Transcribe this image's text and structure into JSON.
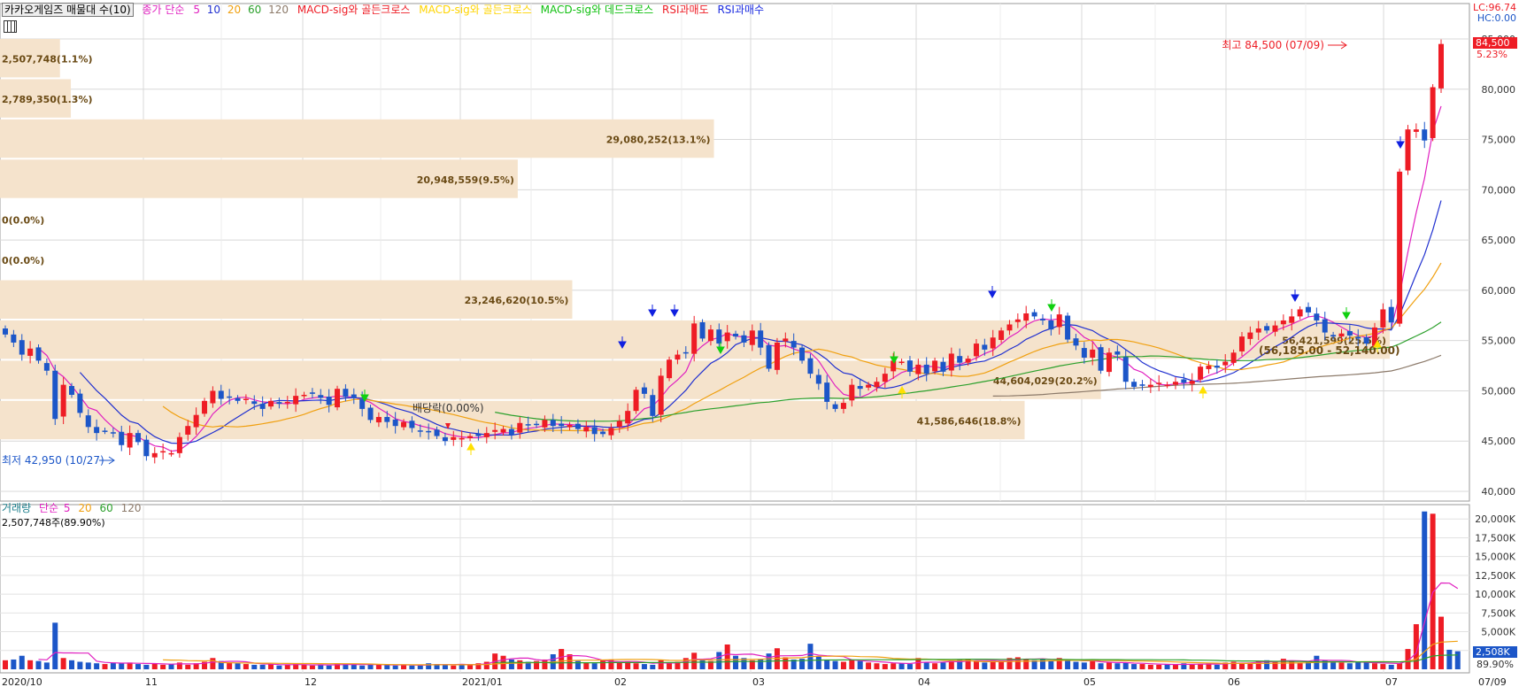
{
  "legend": {
    "title": "카카오게임즈 매물대 수(10)",
    "ma_label": "종가 단순",
    "ma5": "5",
    "ma10": "10",
    "ma20": "20",
    "ma60": "60",
    "ma120": "120",
    "sig1": "MACD-sig와 골든크로스",
    "sig2": "MACD-sig와 골든크로스",
    "sig3": "MACD-sig와 데드크로스",
    "sig4": "RSI과매도",
    "sig5": "RSI과매수"
  },
  "corner": {
    "lc": "LC:96.74",
    "hc": "HC:0.00"
  },
  "volume_legend": {
    "title": "거래량",
    "ma_label": "단순",
    "ma5": "5",
    "ma20": "20",
    "ma60": "60",
    "ma120": "120",
    "current": "2,507,748주(89.90%)"
  },
  "colors": {
    "up": "#ee1c25",
    "down": "#1c56c8",
    "ma5": "#e020c0",
    "ma10": "#2030d0",
    "ma20": "#f0a010",
    "ma60": "#2ca02c",
    "ma120": "#8c7a6a",
    "profile": "#f5e3cc",
    "profile_text": "#6a4a14"
  },
  "chart_data": {
    "type": "candlestick",
    "title": "카카오게임즈",
    "price_axis": {
      "ylim": [
        40000,
        85000
      ],
      "ticks": [
        "40,000",
        "45,000",
        "50,000",
        "55,000",
        "60,000",
        "65,000",
        "70,000",
        "75,000",
        "80,000",
        "85,000"
      ]
    },
    "x_labels": [
      "2020/10",
      "11",
      "12",
      "2021/01",
      "02",
      "03",
      "04",
      "05",
      "06",
      "07",
      "07/09"
    ],
    "volume_profile": [
      {
        "price_low": 85000,
        "price_high": 81000,
        "label": "2,507,748(1.1%)",
        "pct": 1.1
      },
      {
        "price_low": 81000,
        "price_high": 77000,
        "label": "2,789,350(1.3%)",
        "pct": 1.3
      },
      {
        "price_low": 77000,
        "price_high": 73000,
        "label": "29,080,252(13.1%)",
        "pct": 13.1
      },
      {
        "price_low": 73000,
        "price_high": 69000,
        "label": "20,948,559(9.5%)",
        "pct": 9.5
      },
      {
        "price_low": 69000,
        "price_high": 65000,
        "label": "0(0.0%)",
        "pct": 0.0
      },
      {
        "price_low": 65000,
        "price_high": 61000,
        "label": "0(0.0%)",
        "pct": 0.0
      },
      {
        "price_low": 61000,
        "price_high": 57000,
        "label": "23,246,620(10.5%)",
        "pct": 10.5
      },
      {
        "price_low": 57000,
        "price_high": 53000,
        "label": "56,421,599(25.5%)",
        "pct": 25.5
      },
      {
        "price_low": 53000,
        "price_high": 49000,
        "label": "44,604,029(20.2%)",
        "pct": 20.2
      },
      {
        "price_low": 49000,
        "price_high": 45000,
        "label": "41,586,646(18.8%)",
        "pct": 18.8
      }
    ],
    "annotations": {
      "high": "최고 84,500 (07/09)",
      "low": "최저 42,950 (10/27)",
      "dividend": "배당락(0.00%)",
      "ma_values": "(56,185.00 - 52,140.00)",
      "last_price": "84,500",
      "last_change": "5.23%",
      "last_volume": "2,508K",
      "last_volume_pct": "89.90%"
    },
    "volume_axis": {
      "ylim": [
        0,
        22500
      ],
      "ticks": [
        "2,500K",
        "5,000K",
        "7,500K",
        "10,000K",
        "12,500K",
        "15,000K",
        "17,500K",
        "20,000K"
      ]
    },
    "grid": true,
    "closes": [
      55600,
      54800,
      53600,
      54200,
      53000,
      52000,
      47200,
      50600,
      49600,
      47800,
      46400,
      45800,
      46000,
      45800,
      44600,
      45800,
      44900,
      43500,
      43800,
      44000,
      43800,
      45400,
      46500,
      47600,
      49000,
      50000,
      49200,
      49400,
      49000,
      49200,
      48700,
      48200,
      49000,
      48700,
      48900,
      49500,
      49600,
      49700,
      49300,
      48600,
      50200,
      49400,
      49300,
      48200,
      47100,
      47400,
      46900,
      46500,
      46900,
      46300,
      46000,
      45900,
      45500,
      45000,
      45400,
      45300,
      45500,
      45500,
      45800,
      46100,
      46200,
      45600,
      46800,
      46600,
      46600,
      47100,
      46500,
      46500,
      46600,
      46200,
      46400,
      45700,
      45700,
      46300,
      47000,
      48000,
      50100,
      49700,
      47500,
      51500,
      53100,
      53600,
      53800,
      56700,
      55200,
      56100,
      54700,
      55800,
      55400,
      54800,
      56000,
      54300,
      52200,
      54800,
      55200,
      54300,
      53000,
      51700,
      50700,
      48900,
      48200,
      48800,
      50600,
      50200,
      50600,
      50900,
      51700,
      53000,
      52900,
      51900,
      52600,
      51700,
      53000,
      51900,
      53700,
      52800,
      53200,
      54700,
      54100,
      55300,
      56000,
      56600,
      57100,
      57700,
      57400,
      57000,
      56100,
      57600,
      55100,
      54500,
      53300,
      54100,
      52000,
      53800,
      53600,
      50900,
      50400,
      50500,
      50600,
      50800,
      50600,
      50900,
      50800,
      51000,
      52400,
      52500,
      52300,
      52900,
      53800,
      55400,
      55800,
      56200,
      56000,
      56500,
      57000,
      57400,
      58100,
      57800,
      57000,
      55800,
      55400,
      55700,
      55500,
      55200,
      54700,
      56300,
      58100,
      56800,
      71800,
      76000,
      76000,
      74900,
      80200,
      84500
    ],
    "volumes": [
      1200,
      1300,
      1800,
      1200,
      1100,
      900,
      6200,
      1500,
      1200,
      1000,
      900,
      800,
      700,
      900,
      800,
      900,
      700,
      600,
      800,
      600,
      700,
      900,
      600,
      800,
      1000,
      1500,
      1100,
      900,
      800,
      700,
      600,
      600,
      700,
      500,
      600,
      700,
      600,
      500,
      600,
      500,
      800,
      700,
      600,
      500,
      600,
      700,
      600,
      500,
      600,
      500,
      500,
      800,
      700,
      600,
      500,
      700,
      600,
      800,
      1000,
      2100,
      1800,
      1300,
      1200,
      1000,
      1100,
      1300,
      2000,
      2700,
      2000,
      1100,
      900,
      800,
      1200,
      1300,
      900,
      1000,
      800,
      700,
      600,
      1200,
      800,
      1000,
      1500,
      2200,
      1200,
      1100,
      2300,
      3300,
      1800,
      1500,
      1200,
      1300,
      2100,
      2800,
      1600,
      1300,
      1400,
      3400,
      1700,
      1200,
      1100,
      1000,
      1300,
      1100,
      900,
      800,
      700,
      800,
      800,
      700,
      1500,
      900,
      800,
      900,
      1100,
      1300,
      1400,
      1100,
      900,
      1200,
      1100,
      1500,
      1600,
      1400,
      1200,
      1300,
      1100,
      1500,
      1200,
      1000,
      900,
      1100,
      800,
      900,
      800,
      900,
      700,
      700,
      600,
      600,
      700,
      600,
      800,
      600,
      700,
      800,
      600,
      900,
      1000,
      800,
      900,
      1100,
      1200,
      1000,
      1400,
      1100,
      900,
      1000,
      1800,
      1200,
      1000,
      900,
      800,
      1000,
      900,
      800,
      700,
      600,
      800,
      2700,
      6000,
      21000,
      20700,
      7000,
      2600,
      2400
    ]
  }
}
